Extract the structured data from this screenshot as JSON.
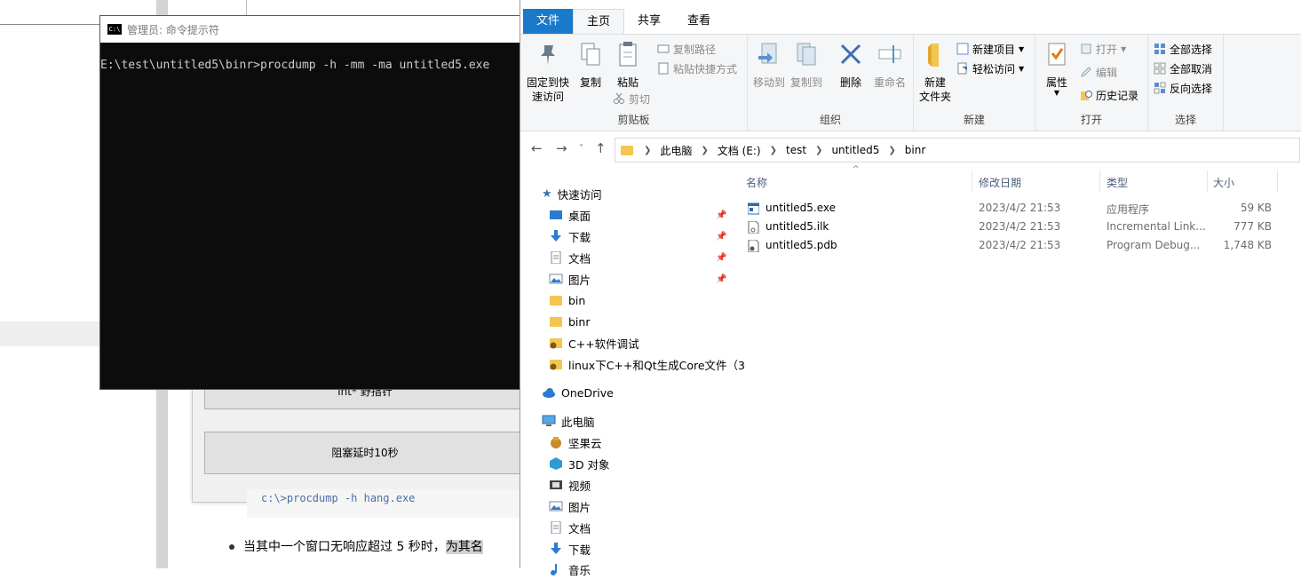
{
  "background": {
    "app_button1": "int* 野指针",
    "app_button2": "阻塞延时10秒",
    "code_line": "c:\\>procdump -h hang.exe",
    "bullet_text": "当其中一个窗口无响应超过 5 秒时，",
    "bullet_highlight": "为其名"
  },
  "cmd": {
    "title": "管理员: 命令提示符",
    "icon_text": "C:\\",
    "line": "E:\\test\\untitled5\\binr>procdump -h -mm -ma untitled5.exe"
  },
  "explorer": {
    "tabs": [
      "文件",
      "主页",
      "共享",
      "查看"
    ],
    "ribbon": {
      "clipboard": {
        "label": "剪贴板",
        "pin_quick_1": "固定到快",
        "pin_quick_2": "速访问",
        "copy": "复制",
        "paste": "粘贴",
        "copy_path": "复制路径",
        "paste_shortcut": "粘贴快捷方式",
        "cut": "剪切"
      },
      "organize": {
        "label": "组织",
        "move_to": "移动到",
        "copy_to": "复制到",
        "delete": "删除",
        "rename": "重命名"
      },
      "new": {
        "label": "新建",
        "new_folder_1": "新建",
        "new_folder_2": "文件夹",
        "new_item": "新建项目",
        "easy_access": "轻松访问"
      },
      "open": {
        "label": "打开",
        "properties": "属性",
        "open": "打开",
        "edit": "编辑",
        "history": "历史记录"
      },
      "select": {
        "label": "选择",
        "select_all": "全部选择",
        "select_none": "全部取消",
        "invert": "反向选择"
      }
    },
    "breadcrumb": [
      "此电脑",
      "文档 (E:)",
      "test",
      "untitled5",
      "binr"
    ],
    "tree": {
      "quick_access": "快速访问",
      "quick_items": [
        "桌面",
        "下载",
        "文档",
        "图片",
        "bin",
        "binr",
        "C++软件调试",
        "linux下C++和Qt生成Core文件（3"
      ],
      "onedrive": "OneDrive",
      "this_pc": "此电脑",
      "pc_items": [
        "坚果云",
        "3D 对象",
        "视频",
        "图片",
        "文档",
        "下载",
        "音乐"
      ]
    },
    "columns": [
      "名称",
      "修改日期",
      "类型",
      "大小"
    ],
    "files": [
      {
        "name": "untitled5.exe",
        "date": "2023/4/2 21:53",
        "type": "应用程序",
        "size": "59 KB"
      },
      {
        "name": "untitled5.ilk",
        "date": "2023/4/2 21:53",
        "type": "Incremental Link...",
        "size": "777 KB"
      },
      {
        "name": "untitled5.pdb",
        "date": "2023/4/2 21:53",
        "type": "Program Debug...",
        "size": "1,748 KB"
      }
    ]
  },
  "colors": {
    "file_tab": "#1979ca",
    "cmd_bg": "#0c0c0c",
    "folder": "#f4c64f"
  }
}
